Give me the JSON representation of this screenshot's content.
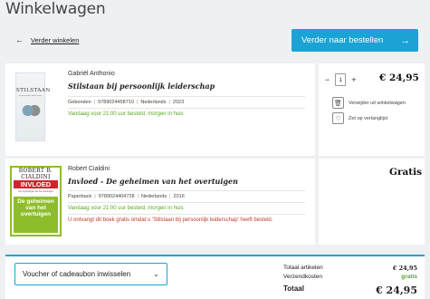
{
  "page_title": "Winkelwagen",
  "nav": {
    "back_label": "Verder winkelen",
    "continue_label": "Verder naar bestellen"
  },
  "items": [
    {
      "author": "Gabriël Anthonio",
      "title": "Stilstaan bij persoonlijk leiderschap",
      "cover_title": "STILSTAAN",
      "cover_subtitle": "bij persoonlijk leiderschap",
      "format": "Gebonden",
      "isbn": "9789024458710",
      "language": "Nederlands",
      "year": "2023",
      "availability": "Vandaag voor 21:00 uur besteld, morgen in huis",
      "quantity": "1",
      "price": "€ 24,95",
      "remove_label": "Verwijder uit winkelwagen",
      "wishlist_label": "Zet op verlanglijst"
    },
    {
      "author": "Robert Cialdini",
      "title": "Invloed - De geheimen van het overtuigen",
      "cover_author": "ROBERT B. CIALDINI",
      "cover_title": "INVLOED",
      "cover_subtitle": "De psychologie van het overtuigen",
      "cover_text": "De geheimen van het overtuigen",
      "format": "Paperback",
      "isbn": "9789024404728",
      "language": "Nederlands",
      "year": "2016",
      "availability": "Vandaag voor 21:00 uur besteld, morgen in huis",
      "note": "U ontvangt dit boek gratis omdat u 'Stilstaan bij persoonlijk leiderschap' heeft besteld.",
      "price": "Gratis"
    }
  ],
  "voucher_label": "Voucher of cadeaubon inwisselen",
  "summary": {
    "total_items_label": "Totaal artikelen",
    "total_items_value": "€ 24,95",
    "shipping_label": "Verzendkosten",
    "shipping_value": "gratis",
    "total_label": "Totaal",
    "total_value": "€ 24,95"
  },
  "colors": {
    "accent": "#1aa3d4",
    "available": "#5aa823",
    "note": "#c0392b"
  }
}
